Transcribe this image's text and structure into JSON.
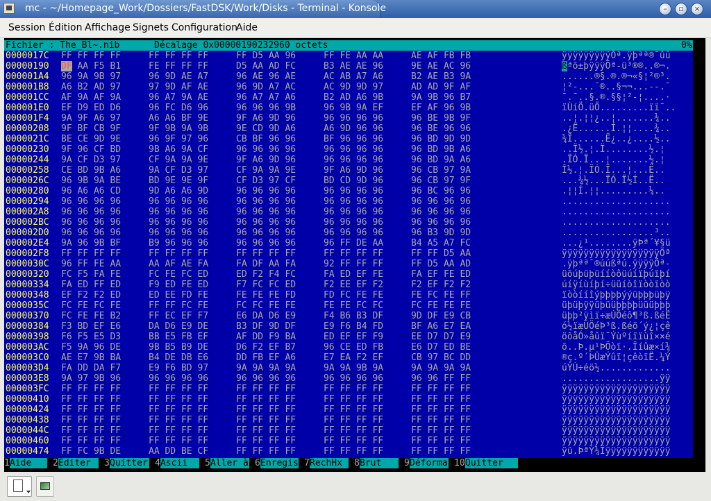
{
  "window": {
    "title": "mc - ~/Homepage_Work/Dossiers/FastDSK/Work/Disks - Terminal - Konsole",
    "app_icon": "konsole-icon",
    "controls": {
      "minimize": "minimize-icon",
      "maximize": "maximize-icon",
      "close": "close-icon"
    }
  },
  "menu": [
    "Session",
    "Édition",
    "Affichage",
    "Signets",
    "Configuration",
    "Aide"
  ],
  "viewer": {
    "header": {
      "file": "Fichier : The_Bl~.nib",
      "offset": "Décalage 0x00000190232960 octets",
      "percent": "0%"
    },
    "rows": [
      {
        "addr": "0000017C",
        "hex": [
          "FF FF FF FF",
          "FF FF FF FF",
          "FF D5 AA 96",
          "FF FE AA AA",
          "AE AF FB FB"
        ],
        "ascii": "ÿÿÿÿÿÿÿÿÿÕª.ÿþªª®¯ûû"
      },
      {
        "addr": "00000190",
        "hex": [
          "DF AA F5 B1",
          "FE FF FF FF",
          "D5 AA AD FC",
          "B3 AE AE 96",
          "9E AE AC 96"
        ],
        "ascii": "ßªõ±þÿÿÿÕª-ü³®®..®¬."
      },
      {
        "addr": "000001A4",
        "hex": [
          "96 9A 9B 97",
          "96 9D AE A7",
          "96 AE 96 AE",
          "AC AB A7 A6",
          "B2 AE B3 9A"
        ],
        "ascii": "......®§.®.®¬«§¦²®³."
      },
      {
        "addr": "000001B8",
        "hex": [
          "A6 B2 AD 97",
          "97 9D AF AE",
          "96 9D A7 AC",
          "AC 9D 9D 97",
          "AD AD 9F AF"
        ],
        "ascii": "¦²-...¯®..§¬¬...--.¯"
      },
      {
        "addr": "000001CC",
        "hex": [
          "AF 9A AF 9A",
          "96 A7 9A AE",
          "96 A7 A7 A6",
          "B2 AD A6 9B",
          "9A 9B 96 B7"
        ],
        "ascii": "¯.¯..§.®.§§¦²-¦....·"
      },
      {
        "addr": "000001E0",
        "hex": [
          "EF D9 ED D6",
          "96 FC D6 96",
          "96 96 96 9B",
          "96 9B 9A EF",
          "EF AF 96 9B"
        ],
        "ascii": "ïÙíÖ.üÖ.........ïï¯.."
      },
      {
        "addr": "000001F4",
        "hex": [
          "9A 9F A6 97",
          "A6 A6 BF 9E",
          "9F A6 9D 96",
          "96 96 96 96",
          "96 BE 9B 9F"
        ],
        "ascii": "..¦.¦¦¿..¦.......¾.."
      },
      {
        "addr": "00000208",
        "hex": [
          "9F BF CB 9F",
          "9F 9B 9A 9B",
          "9E CD 9D A6",
          "A6 9D 96 96",
          "96 BE 96 96"
        ],
        "ascii": ".¿Ë......Í.¦¦....¾.."
      },
      {
        "addr": "0000021C",
        "hex": [
          "BE CE 9D 9E",
          "96 9F 97 96",
          "CB BF 96 96",
          "BF 96 96 96",
          "96 BD 9D 9D"
        ],
        "ascii": "¾Î......Ë¿..¿....½.."
      },
      {
        "addr": "00000230",
        "hex": [
          "9F 96 CF BD",
          "9B A6 9A CF",
          "96 96 96 96",
          "96 96 96 96",
          "96 BD 9B A6"
        ],
        "ascii": "..Ï½.¦.Ï........½.¦"
      },
      {
        "addr": "00000244",
        "hex": [
          "9A CF D3 97",
          "CF 9A 9A 9E",
          "9F A6 9D 96",
          "96 96 96 96",
          "96 BD 9A A6"
        ],
        "ascii": ".ÏÓ.Ï...¦.......½.¦"
      },
      {
        "addr": "00000258",
        "hex": [
          "CE BD 9B A6",
          "9A CF D3 97",
          "CF 9A 9A 9E",
          "9F A6 9D 96",
          "96 CB 97 9A"
        ],
        "ascii": "Î½.¦.ÏÓ.Ï...¦...Ë.."
      },
      {
        "addr": "0000026C",
        "hex": [
          "96 9B 9A BE",
          "BD 9E 9E 9F",
          "CF D3 97 CF",
          "BD CD 9D 96",
          "96 CB 97 9F"
        ],
        "ascii": "...¾½...ÏÓ.Ï½Í..Ë.."
      },
      {
        "addr": "00000280",
        "hex": [
          "96 A6 A6 CD",
          "9D A6 A6 9D",
          "96 96 96 96",
          "96 96 96 96",
          "96 BC 96 96"
        ],
        "ascii": ".¦¦Í.¦¦.........¼.."
      },
      {
        "addr": "00000294",
        "hex": [
          "96 96 96 96",
          "96 96 96 96",
          "96 96 96 96",
          "96 96 96 96",
          "96 96 96 96"
        ],
        "ascii": "...................."
      },
      {
        "addr": "000002A8",
        "hex": [
          "96 96 96 96",
          "96 96 96 96",
          "96 96 96 96",
          "96 96 96 96",
          "96 96 96 96"
        ],
        "ascii": "...................."
      },
      {
        "addr": "000002BC",
        "hex": [
          "96 96 96 96",
          "96 96 96 96",
          "96 96 96 96",
          "96 96 96 96",
          "96 96 96 96"
        ],
        "ascii": "...................."
      },
      {
        "addr": "000002D0",
        "hex": [
          "96 96 96 96",
          "96 96 96 96",
          "96 96 96 96",
          "96 96 96 96",
          "96 B3 9D 9D"
        ],
        "ascii": ".................³.."
      },
      {
        "addr": "000002E4",
        "hex": [
          "9A 96 9B BF",
          "B9 96 96 96",
          "96 96 96 96",
          "96 FF DE AA",
          "B4 A5 A7 FC"
        ],
        "ascii": "...¿¹........ÿÞª´¥§ü"
      },
      {
        "addr": "000002F8",
        "hex": [
          "FF FF FF FF",
          "FF FF FF FF",
          "FF FF FF FF",
          "FF FF FF FF",
          "FF FF D5 AA"
        ],
        "ascii": "ÿÿÿÿÿÿÿÿÿÿÿÿÿÿÿÿÿÿÕª"
      },
      {
        "addr": "0000030C",
        "hex": [
          "96 FF FE AA",
          "AA AF AE FA",
          "FA DF AA FA",
          "92 FF FF FF",
          "FF D5 AA AD"
        ],
        "ascii": ".ÿþªª¯®úúßªú.ÿÿÿÿÕª-"
      },
      {
        "addr": "00000320",
        "hex": [
          "FC F5 FA FE",
          "FC FE FC ED",
          "ED F2 F4 FC",
          "FA ED EF FE",
          "FA EF FE ED"
        ],
        "ascii": "üõúþüþüííòôüúíïþúïþí"
      },
      {
        "addr": "00000334",
        "hex": [
          "FA ED FF ED",
          "F9 ED FE ED",
          "F7 FC FC ED",
          "F2 EE EF F2",
          "F2 EF F2 F2"
        ],
        "ascii": "úíÿíùíþí÷üüíòîïòòïòò"
      },
      {
        "addr": "00000348",
        "hex": [
          "EF F2 F2 ED",
          "ED EE FD FE",
          "FE FE FE FD",
          "FD FC FE FE",
          "FE FC FE FF"
        ],
        "ascii": "ïòòííîýþþþþýýüþþþüþÿ"
      },
      {
        "addr": "0000035C",
        "hex": [
          "FC FE FC FE",
          "FF FF FC FE",
          "FC FC FE FE",
          "FE FE FC FC",
          "FC FE FE FE"
        ],
        "ascii": "üþüþÿÿüþüüþþþþüüüþþþ"
      },
      {
        "addr": "00000370",
        "hex": [
          "FC FE FE B2",
          "FF EC EF F7",
          "E6 DA D6 E9",
          "F4 B6 B3 DF",
          "9D DF E9 CB"
        ],
        "ascii": "üþþ²ÿìï÷æÚÖéô¶³ß.ßéË"
      },
      {
        "addr": "00000384",
        "hex": [
          "F3 BD EF E6",
          "DA D6 E9 DE",
          "B3 DF 9D DF",
          "E9 F6 B4 FD",
          "BF A6 E7 EA"
        ],
        "ascii": "ó½ïæÚÖéÞ³ß.ßéö´ý¿¦çê"
      },
      {
        "addr": "00000398",
        "hex": [
          "F6 F5 E5 D3",
          "BB E5 FB EF",
          "AF DD F9 BA",
          "ED EF EF F9",
          "EE D7 D7 E9"
        ],
        "ascii": "öõåÓ»åûï¯Ýùºíïïùî××é"
      },
      {
        "addr": "000003AC",
        "hex": [
          "F5 9A 96 DE",
          "9B B5 B9 DE",
          "D6 F2 EF B7",
          "96 CE ED FB",
          "E6 D7 ED BE"
        ],
        "ascii": "õ..Þ.µ¹ÞÖòï·.Îíûæ×í¾"
      },
      {
        "addr": "000003C0",
        "hex": [
          "AE E7 9B BA",
          "B4 DE DB E6",
          "DD FB EF A6",
          "E7 EA F2 EF",
          "CB 97 BC DD"
        ],
        "ascii": "®ç.º´ÞÛæÝûï¦çêòïË.¼Ý"
      },
      {
        "addr": "000003D4",
        "hex": [
          "FA DD DA F7",
          "E9 F6 BD 97",
          "9A 9A 9A 9A",
          "9A 9A 9B 9A",
          "9A 9A 9A 9A"
        ],
        "ascii": "úÝÚ÷éö½............."
      },
      {
        "addr": "000003E8",
        "hex": [
          "9A 97 9B 96",
          "96 96 96 96",
          "96 96 96 96",
          "96 96 96 96",
          "96 96 FF FF"
        ],
        "ascii": "..................ÿÿ"
      },
      {
        "addr": "000003FC",
        "hex": [
          "FF FF FF FF",
          "FF FF FF FF",
          "FF FF FF FF",
          "FF FF FF FF",
          "FF FF FF FF"
        ],
        "ascii": "ÿÿÿÿÿÿÿÿÿÿÿÿÿÿÿÿÿÿÿÿ"
      },
      {
        "addr": "00000410",
        "hex": [
          "FF FF FF FF",
          "FF FF FF FF",
          "FF FF FF FF",
          "FF FF FF FF",
          "FF FF FF FF"
        ],
        "ascii": "ÿÿÿÿÿÿÿÿÿÿÿÿÿÿÿÿÿÿÿÿ"
      },
      {
        "addr": "00000424",
        "hex": [
          "FF FF FF FF",
          "FF FF FF FF",
          "FF FF FF FF",
          "FF FF FF FF",
          "FF FF FF FF"
        ],
        "ascii": "ÿÿÿÿÿÿÿÿÿÿÿÿÿÿÿÿÿÿÿÿ"
      },
      {
        "addr": "00000438",
        "hex": [
          "FF FF FF FF",
          "FF FF FF FF",
          "FF FF FF FF",
          "FF FF FF FF",
          "FF FF FF FF"
        ],
        "ascii": "ÿÿÿÿÿÿÿÿÿÿÿÿÿÿÿÿÿÿÿÿ"
      },
      {
        "addr": "0000044C",
        "hex": [
          "FF FF FF FF",
          "FF FF FF FF",
          "FF FF FF FF",
          "FF FF FF FF",
          "FF FF FF FF"
        ],
        "ascii": "ÿÿÿÿÿÿÿÿÿÿÿÿÿÿÿÿÿÿÿÿ"
      },
      {
        "addr": "00000460",
        "hex": [
          "FF FF FF FF",
          "FF FF FF FF",
          "FF FF FF FF",
          "FF FF FF FF",
          "FF FF FF FF"
        ],
        "ascii": "ÿÿÿÿÿÿÿÿÿÿÿÿÿÿÿÿÿÿÿÿ"
      },
      {
        "addr": "00000474",
        "hex": [
          "FF FC 9B DE",
          "AA DD BE CF",
          "FF FF FF FF",
          "FF FF FF FF",
          "FF FF FF FF"
        ],
        "ascii": "ÿü.ÞªÝ¾Ïÿÿÿÿÿÿÿÿÿÿÿÿ"
      }
    ],
    "cursor": {
      "row": 1,
      "byte": "DF"
    }
  },
  "fkeys": [
    {
      "num": "1",
      "label": "Aide"
    },
    {
      "num": "2",
      "label": "Éditer"
    },
    {
      "num": "3",
      "label": "Quitter"
    },
    {
      "num": "4",
      "label": "Ascii"
    },
    {
      "num": "5",
      "label": "Aller à"
    },
    {
      "num": "6",
      "label": "Enregis"
    },
    {
      "num": "7",
      "label": "RechHx"
    },
    {
      "num": "8",
      "label": "Brut"
    },
    {
      "num": "9",
      "label": "Déforma"
    },
    {
      "num": "10",
      "label": "Quitter"
    }
  ],
  "colors": {
    "terminal_bg": "#0000a8",
    "header_bg": "#00a8a8",
    "address": "#fcfc54",
    "text": "#a8a8a8",
    "cursor_fg": "#fc5454"
  },
  "toolbar": {
    "new_session_icon": "new-session-icon",
    "session_tab_icon": "terminal-session-icon"
  }
}
